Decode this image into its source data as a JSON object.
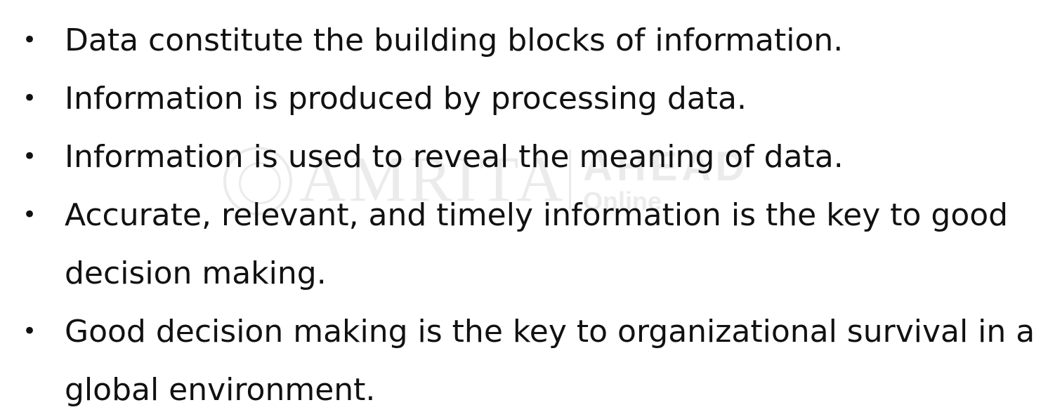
{
  "watermark": {
    "brand": "AMRITA",
    "sub_top": "AHEAD",
    "sub_bottom": "Online"
  },
  "bullet_marker": "•",
  "bullets": [
    {
      "lines": [
        "Data constitute the building blocks of information."
      ]
    },
    {
      "lines": [
        "Information is produced by processing data."
      ]
    },
    {
      "lines": [
        "Information is used to reveal the meaning of data."
      ]
    },
    {
      "lines": [
        "Accurate, relevant, and timely information is the key to good",
        "decision making."
      ]
    },
    {
      "lines": [
        "Good decision making is the key to organizational survival in a",
        "global environment."
      ]
    }
  ]
}
